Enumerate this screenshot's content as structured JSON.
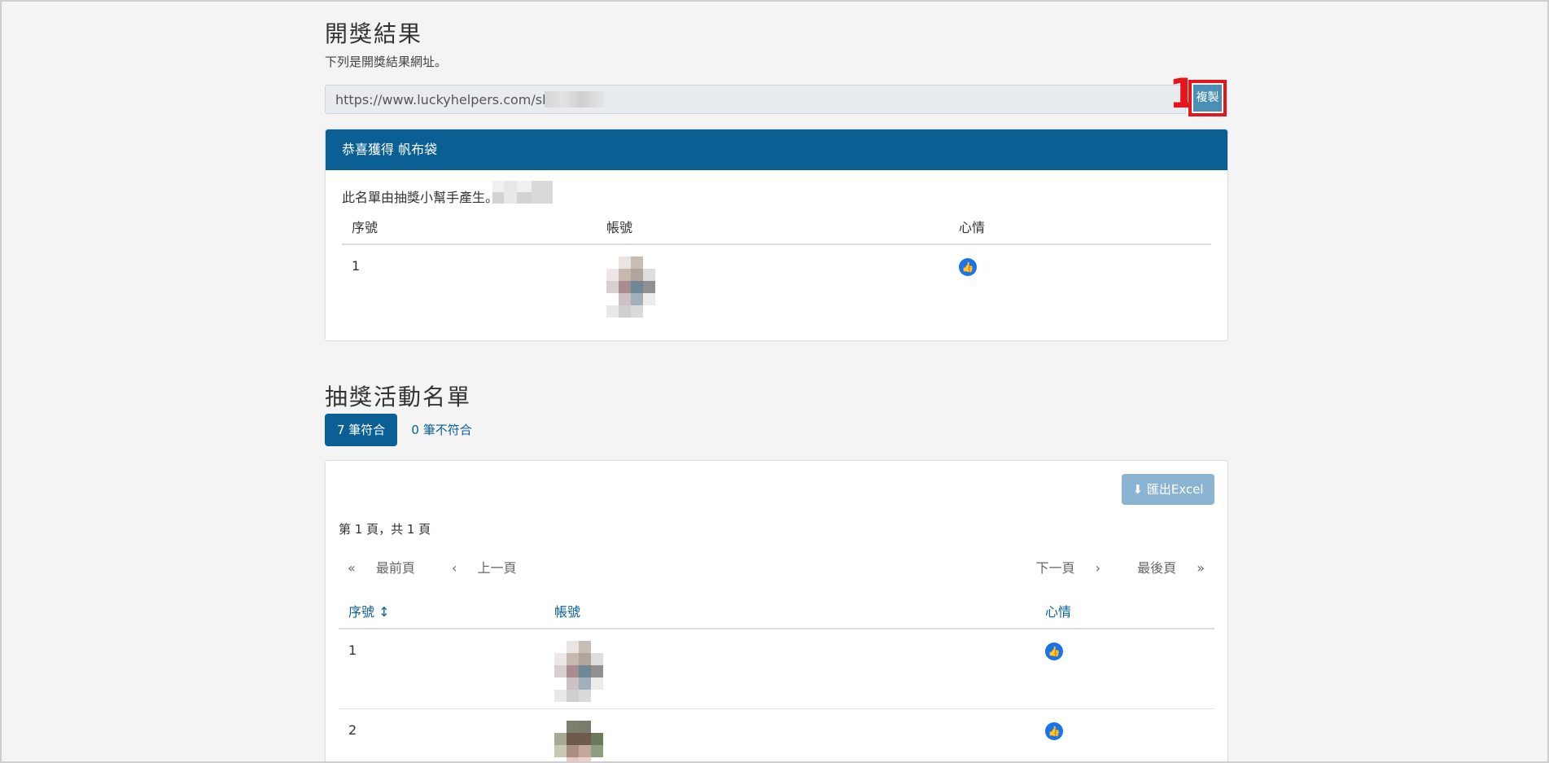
{
  "result": {
    "title": "開獎結果",
    "description": "下列是開獎結果網址。",
    "url_value": "https://www.luckyhelpers.com/show/",
    "copy_label": "複製",
    "annotation_number": "1"
  },
  "prize_card": {
    "header": "恭喜獲得 帆布袋",
    "note": "此名單由抽獎小幫手產生。",
    "columns": [
      "序號",
      "帳號",
      "心情"
    ],
    "rows": [
      {
        "index": "1",
        "mood_icon": "thumbs-up-icon"
      }
    ]
  },
  "activity": {
    "title": "抽獎活動名單",
    "tab_match": "7 筆符合",
    "tab_nomatch": "0 筆不符合",
    "export_label": "匯出Excel",
    "page_info": "第 1 頁，共 1 頁",
    "pager": {
      "first": "最前頁",
      "prev": "上一頁",
      "next": "下一頁",
      "last": "最後頁"
    },
    "columns": [
      "序號",
      "帳號",
      "心情"
    ],
    "rows": [
      {
        "index": "1",
        "mood_icon": "thumbs-up-icon"
      },
      {
        "index": "2",
        "mood_icon": "thumbs-up-icon"
      }
    ]
  },
  "colors": {
    "primary": "#0a6094",
    "annotation": "#e8141b",
    "like": "#1a73e8"
  }
}
